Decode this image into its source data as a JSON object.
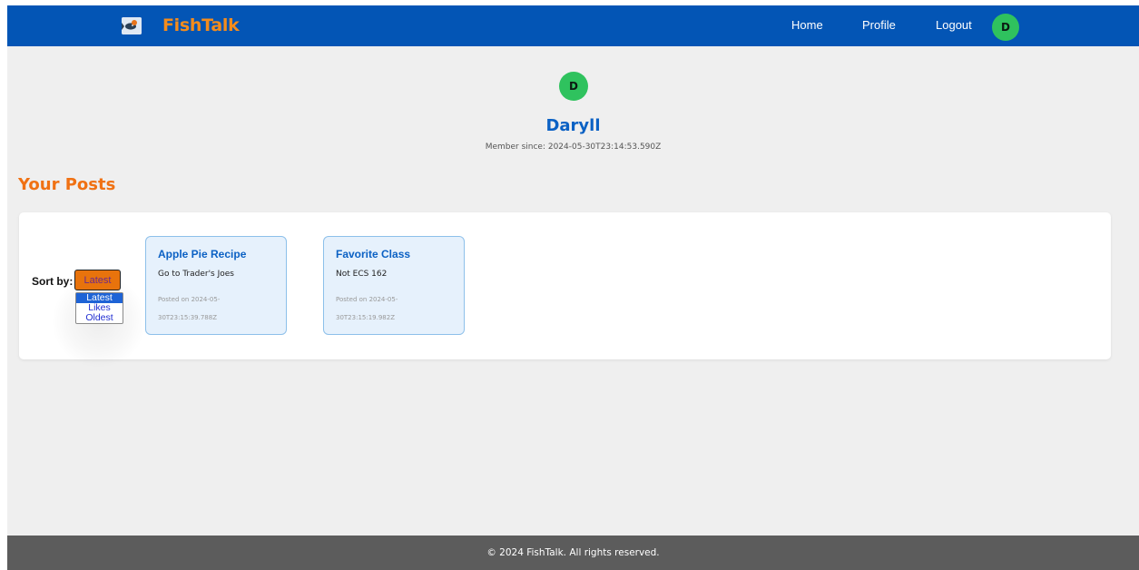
{
  "header": {
    "brand": "FishTalk",
    "nav": [
      "Home",
      "Profile",
      "Logout"
    ],
    "avatar_initial": "D"
  },
  "profile": {
    "avatar_initial": "D",
    "username": "Daryll",
    "member_since": "Member since: 2024-05-30T23:14:53.590Z"
  },
  "posts_section": {
    "title": "Your Posts",
    "sort_label": "Sort by:",
    "sort_selected": "Latest",
    "sort_options": [
      "Latest",
      "Likes",
      "Oldest"
    ],
    "posts": [
      {
        "title": "Apple Pie Recipe",
        "body": "Go to Trader's Joes",
        "date": "Posted on 2024-05-30T23:15:39.788Z"
      },
      {
        "title": "Favorite Class",
        "body": "Not ECS 162",
        "date": "Posted on 2024-05-30T23:15:19.982Z"
      }
    ]
  },
  "footer": {
    "text": "© 2024 FishTalk. All rights reserved."
  },
  "colors": {
    "nav_bg": "#0355b5",
    "brand": "#f48c1c",
    "avatar": "#2fc25e",
    "heading_blue": "#0b61c4",
    "section_orange": "#f07113",
    "card_bg": "#e6f1fc",
    "footer_bg": "#5c5c5c"
  },
  "icons": {
    "logo": "fish-logo-icon"
  }
}
